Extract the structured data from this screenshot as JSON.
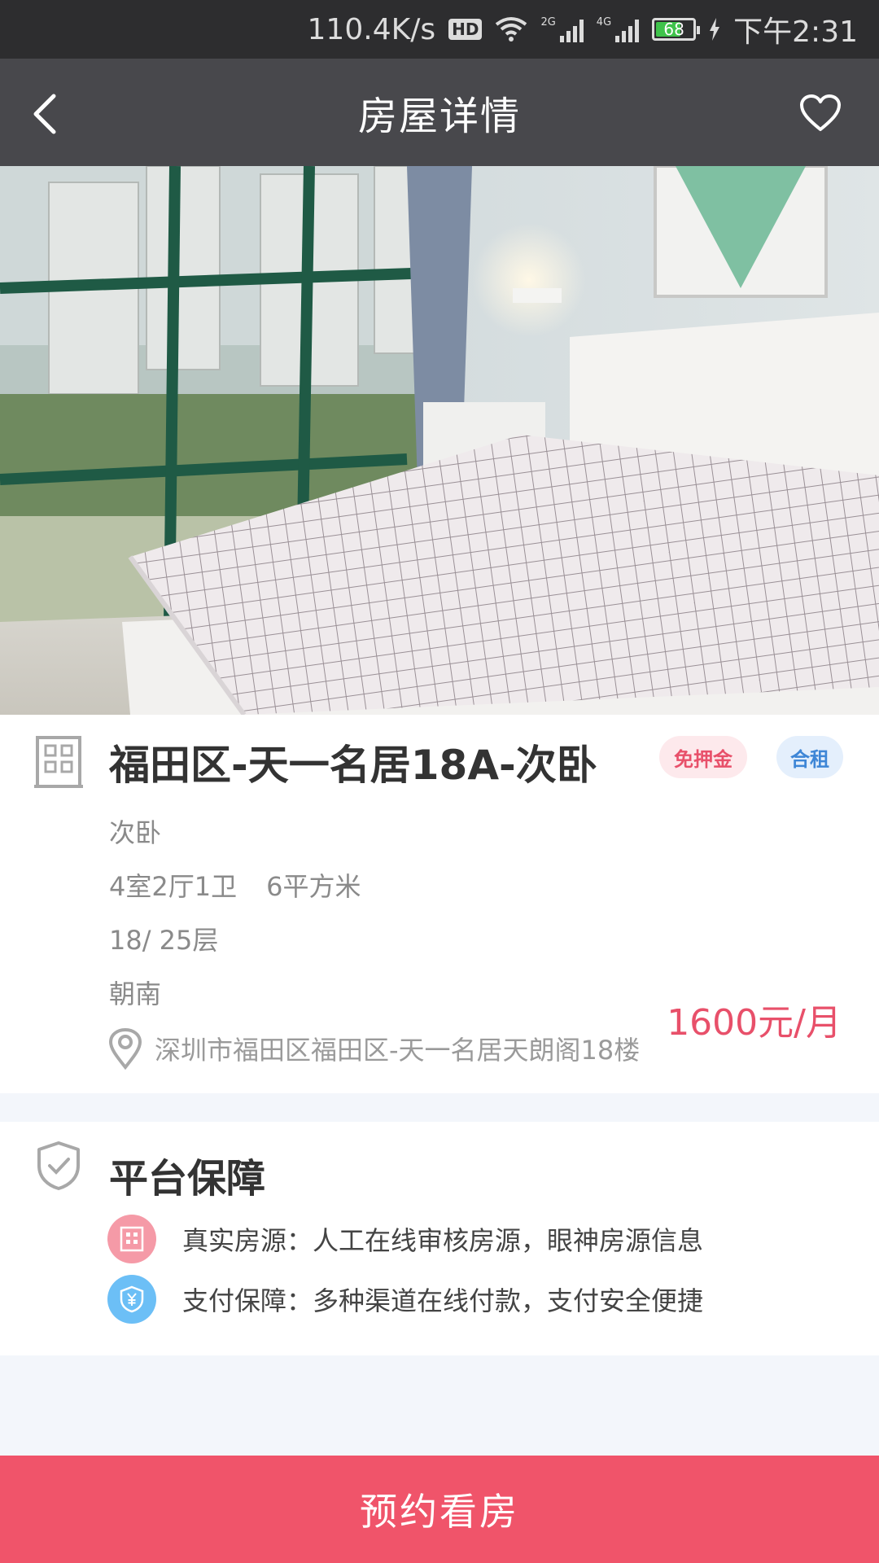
{
  "status_bar": {
    "speed": "110.4K/s",
    "hd": "HD",
    "net1": "2G",
    "net2": "4G",
    "battery": "68",
    "battery_level": 0.68,
    "time": "下午2:31"
  },
  "header": {
    "title": "房屋详情",
    "back_icon": "chevron-left-icon",
    "favorite_icon": "heart-outline-icon"
  },
  "listing": {
    "title": "福田区-天一名居18A-次卧",
    "tags": [
      "免押金",
      "合租"
    ],
    "room_type": "次卧",
    "layout": "4室2厅1卫",
    "area": "6平方米",
    "floor": "18/ 25层",
    "orientation": "朝南",
    "address": "深圳市福田区福田区-天一名居天朗阁18楼",
    "price": "1600元/月",
    "colors": {
      "accent": "#f0546a",
      "tag_blue": "#3e86d6"
    }
  },
  "guarantee": {
    "title": "平台保障",
    "items": [
      {
        "icon": "building-icon",
        "text": "真实房源：人工在线审核房源，眼神房源信息"
      },
      {
        "icon": "shield-yuan-icon",
        "text": "支付保障：多种渠道在线付款，支付安全便捷"
      }
    ]
  },
  "cta": {
    "label": "预约看房"
  }
}
